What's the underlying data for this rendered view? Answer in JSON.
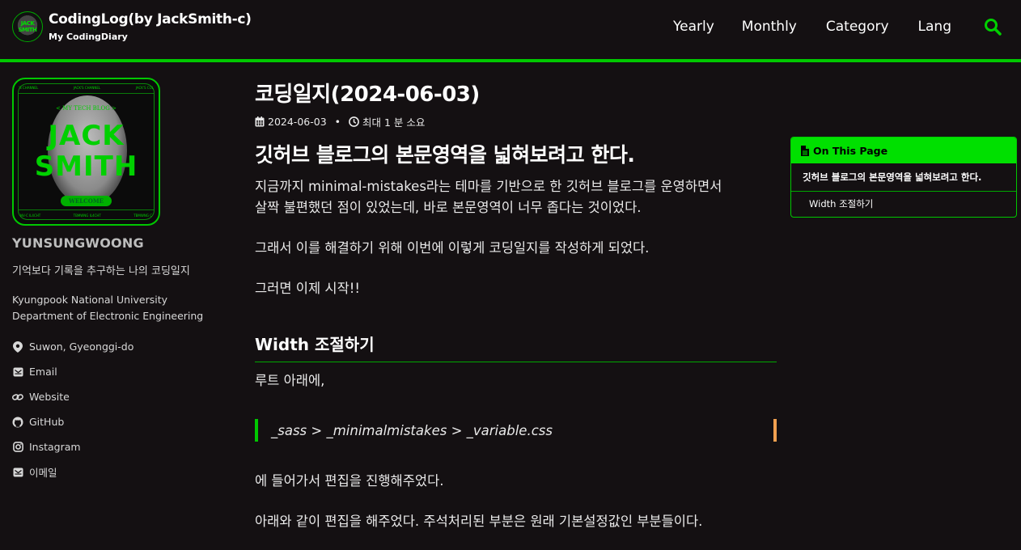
{
  "header": {
    "logo_text_top": "JACK",
    "logo_text_bottom": "SMITH",
    "title": "CodingLog(by JackSmith-c)",
    "subtitle": "My CodingDiary",
    "nav": [
      "Yearly",
      "Monthly",
      "Category",
      "Lang"
    ],
    "search_icon": "search-icon"
  },
  "sidebar": {
    "avatar": {
      "top_labels": [
        "'S CHANNEL",
        "JACK'S CHANNEL",
        "JACK'S COL"
      ],
      "blog": "< MY TECH BLOG >",
      "line1": "JACK",
      "line2": "SMITH",
      "welcome": "WELCOME",
      "bottom_labels": [
        "NV-C IL4CHT",
        "TBMWNG IL4CHT",
        "TBMWNG C"
      ]
    },
    "name": "YUNSUNGWOONG",
    "bio": "기억보다 기록을 추구하는 나의 코딩일지",
    "school_line1": "Kyungpook National University",
    "school_line2": "Department of Electronic Engineering",
    "links": [
      {
        "icon": "map-marker-icon",
        "label": "Suwon, Gyeonggi-do"
      },
      {
        "icon": "envelope-icon",
        "label": "Email"
      },
      {
        "icon": "link-icon",
        "label": "Website"
      },
      {
        "icon": "github-icon",
        "label": "GitHub"
      },
      {
        "icon": "instagram-icon",
        "label": "Instagram"
      },
      {
        "icon": "envelope-icon",
        "label": "이메일"
      }
    ]
  },
  "post": {
    "title": "코딩일지(2024-06-03)",
    "date": "2024-06-03",
    "read_time": "최대 1 분 소요",
    "heading1": "깃허브 블로그의 본문영역을 넓혀보려고 한다.",
    "para1_line1": "지금까지 minimal-mistakes라는 테마를 기반으로 한 깃허브 블로그를 운영하면서",
    "para1_line2": "살짝 불편했던 점이 있었는데, 바로 본문영역이 너무 좁다는 것이었다.",
    "para2": "그래서 이를 해결하기 위해 이번에 이렇게 코딩일지를 작성하게 되었다.",
    "para3": "그러면 이제 시작!!",
    "heading2": "Width 조절하기",
    "para4": "루트 아래에,",
    "quote": "_sass > _minimalmistakes > _variable.css",
    "para5": "에 들어가서 편집을 진행해주었다.",
    "para6": "아래와 같이 편집을 해주었다. 주석처리된 부분은 원래 기본설정값인 부분들이다."
  },
  "toc": {
    "title": "On This Page",
    "items": [
      "깃허브 블로그의 본문영역을 넓혀보려고 한다.",
      "Width 조절하기"
    ]
  },
  "colors": {
    "accent": "#00c800",
    "background": "#141012",
    "quote_right_border": "#f0a050"
  }
}
